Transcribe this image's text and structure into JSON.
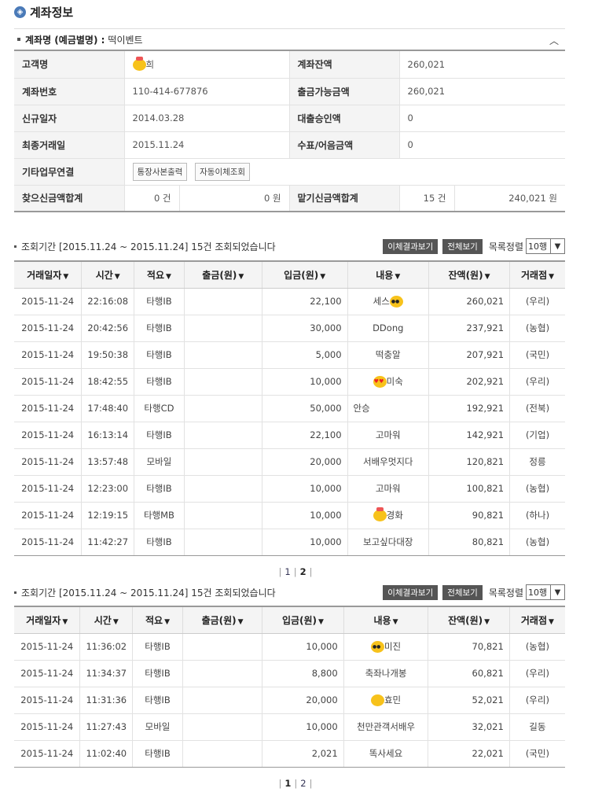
{
  "title": "계좌정보",
  "account": {
    "label": "계좌명 (예금별명) :",
    "alias": "떡이벤트"
  },
  "info": {
    "customer_label": "고객명",
    "customer_value": "희",
    "balance_label": "계좌잔액",
    "balance_value": "260,021",
    "number_label": "계좌번호",
    "number_value": "110-414-677876",
    "withdrawable_label": "출금가능금액",
    "withdrawable_value": "260,021",
    "opened_label": "신규일자",
    "opened_value": "2014.03.28",
    "loan_label": "대출승인액",
    "loan_value": "0",
    "last_label": "최종거래일",
    "last_value": "2015.11.24",
    "check_label": "수표/어음금액",
    "check_value": "0",
    "links_label": "기타업무연결",
    "link1": "통장사본출력",
    "link2": "자동이체조회",
    "find_label": "찾으신금액합계",
    "find_count": "0 건",
    "find_amount": "0 원",
    "deposit_label": "맡기신금액합계",
    "deposit_count": "15 건",
    "deposit_amount": "240,021 원"
  },
  "toolbar": {
    "period": "조회기간 [2015.11.24 ~ 2015.11.24] 15건 조회되었습니다",
    "transfer_btn": "이체결과보기",
    "all_btn": "전체보기",
    "sort_label": "목록정렬",
    "sort_value": "10행"
  },
  "headers": [
    "거래일자",
    "시간",
    "적요",
    "출금(원)",
    "입금(원)",
    "내용",
    "잔액(원)",
    "거래점"
  ],
  "table1": [
    {
      "date": "2015-11-24",
      "time": "22:16:08",
      "memo": "타행IB",
      "out": "",
      "in": "22,100",
      "desc": "세스",
      "bal": "260,021",
      "branch": "(우리)"
    },
    {
      "date": "2015-11-24",
      "time": "20:42:56",
      "memo": "타행IB",
      "out": "",
      "in": "30,000",
      "desc": "DDong",
      "bal": "237,921",
      "branch": "(농협)"
    },
    {
      "date": "2015-11-24",
      "time": "19:50:38",
      "memo": "타행IB",
      "out": "",
      "in": "5,000",
      "desc": "떡충알",
      "bal": "207,921",
      "branch": "(국민)"
    },
    {
      "date": "2015-11-24",
      "time": "18:42:55",
      "memo": "타행IB",
      "out": "",
      "in": "10,000",
      "desc": "미숙",
      "bal": "202,921",
      "branch": "(우리)"
    },
    {
      "date": "2015-11-24",
      "time": "17:48:40",
      "memo": "타행CD",
      "out": "",
      "in": "50,000",
      "desc": "안승",
      "bal": "192,921",
      "branch": "(전북)"
    },
    {
      "date": "2015-11-24",
      "time": "16:13:14",
      "memo": "타행IB",
      "out": "",
      "in": "22,100",
      "desc": "고마워",
      "bal": "142,921",
      "branch": "(기업)"
    },
    {
      "date": "2015-11-24",
      "time": "13:57:48",
      "memo": "모바일",
      "out": "",
      "in": "20,000",
      "desc": "서배우멋지다",
      "bal": "120,821",
      "branch": "정릉"
    },
    {
      "date": "2015-11-24",
      "time": "12:23:00",
      "memo": "타행IB",
      "out": "",
      "in": "10,000",
      "desc": "고마워",
      "bal": "100,821",
      "branch": "(농협)"
    },
    {
      "date": "2015-11-24",
      "time": "12:19:15",
      "memo": "타행MB",
      "out": "",
      "in": "10,000",
      "desc": "경화",
      "bal": "90,821",
      "branch": "(하나)"
    },
    {
      "date": "2015-11-24",
      "time": "11:42:27",
      "memo": "타행IB",
      "out": "",
      "in": "10,000",
      "desc": "보고싶다대장",
      "bal": "80,821",
      "branch": "(농협)"
    }
  ],
  "table2": [
    {
      "date": "2015-11-24",
      "time": "11:36:02",
      "memo": "타행IB",
      "out": "",
      "in": "10,000",
      "desc": "미진",
      "bal": "70,821",
      "branch": "(농협)"
    },
    {
      "date": "2015-11-24",
      "time": "11:34:37",
      "memo": "타행IB",
      "out": "",
      "in": "8,800",
      "desc": "축좌나개봉",
      "bal": "60,821",
      "branch": "(우리)"
    },
    {
      "date": "2015-11-24",
      "time": "11:31:36",
      "memo": "타행IB",
      "out": "",
      "in": "20,000",
      "desc": "효민",
      "bal": "52,021",
      "branch": "(우리)"
    },
    {
      "date": "2015-11-24",
      "time": "11:27:43",
      "memo": "모바일",
      "out": "",
      "in": "10,000",
      "desc": "천만관객서배우",
      "bal": "32,021",
      "branch": "길동"
    },
    {
      "date": "2015-11-24",
      "time": "11:02:40",
      "memo": "타행IB",
      "out": "",
      "in": "2,021",
      "desc": "똑사세요",
      "bal": "22,021",
      "branch": "(국민)"
    }
  ],
  "pager1": {
    "p1": "1",
    "p2": "2"
  },
  "pager2": {
    "p1": "1",
    "p2": "2"
  }
}
